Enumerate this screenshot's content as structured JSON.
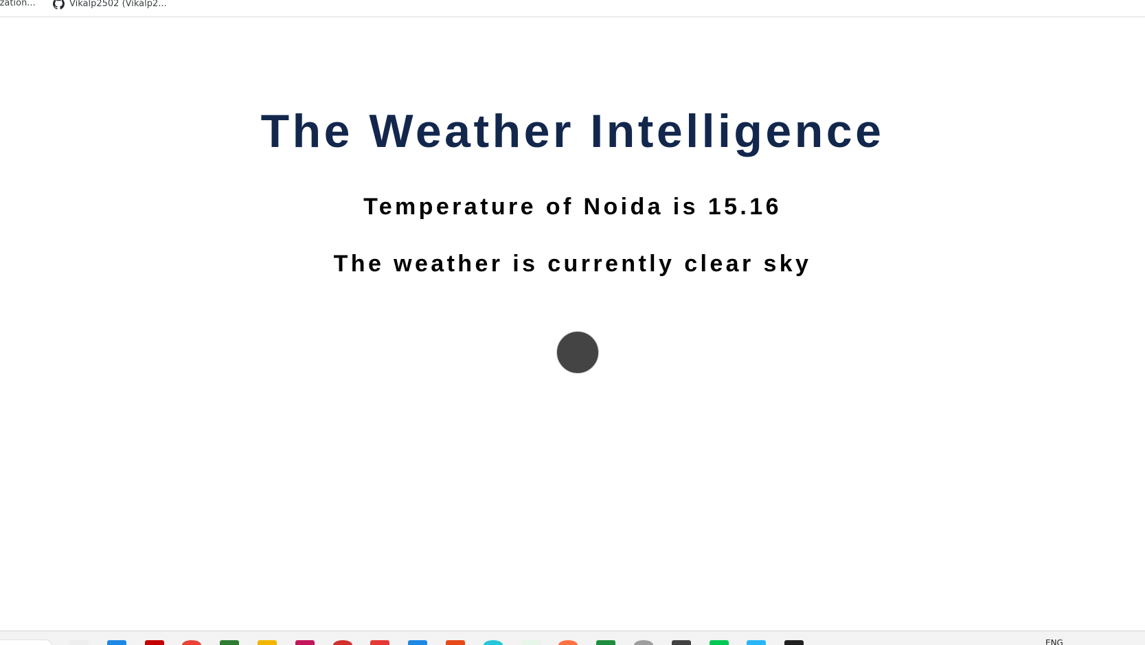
{
  "bookmarks": {
    "items": [
      {
        "label": "ization..."
      },
      {
        "label": "Vikalp2502 (Vikalp2...",
        "icon": "github-icon"
      }
    ]
  },
  "main": {
    "title": "The Weather Intelligence",
    "temperature_text": "Temperature of Noida is 15.16",
    "weather_text": "The weather is currently clear sky"
  },
  "taskbar": {
    "language": "ENG",
    "icons": [
      {
        "name": "file-icon",
        "color": "#eeeeee"
      },
      {
        "name": "task-view-icon",
        "color": "#1e88e5"
      },
      {
        "name": "red-app-icon",
        "color": "#c40000"
      },
      {
        "name": "chrome-icon",
        "color": "#ea4335"
      },
      {
        "name": "green-app-icon",
        "color": "#2e7d32"
      },
      {
        "name": "folder-icon",
        "color": "#f2b600"
      },
      {
        "name": "media-icon",
        "color": "#c2185b"
      },
      {
        "name": "profile-icon",
        "color": "#d32f2f"
      },
      {
        "name": "badge-app-icon",
        "color": "#e53935"
      },
      {
        "name": "vscode-icon",
        "color": "#1e88e5"
      },
      {
        "name": "office-icon",
        "color": "#e64a19"
      },
      {
        "name": "teal-app-icon",
        "color": "#26c6da"
      },
      {
        "name": "white-app-icon",
        "color": "#e8f5e9"
      },
      {
        "name": "orange-app-icon",
        "color": "#ff7043"
      },
      {
        "name": "sheets-icon",
        "color": "#1e8e3e"
      },
      {
        "name": "refresh-app-icon",
        "color": "#9e9e9e"
      },
      {
        "name": "dark-app-icon",
        "color": "#424242"
      },
      {
        "name": "green-square-icon",
        "color": "#00c853"
      },
      {
        "name": "blue-app-icon",
        "color": "#29b6f6"
      },
      {
        "name": "terminal-icon",
        "color": "#212121"
      }
    ]
  },
  "colors": {
    "title": "#13274d",
    "text": "#000000",
    "loader": "#444444"
  }
}
